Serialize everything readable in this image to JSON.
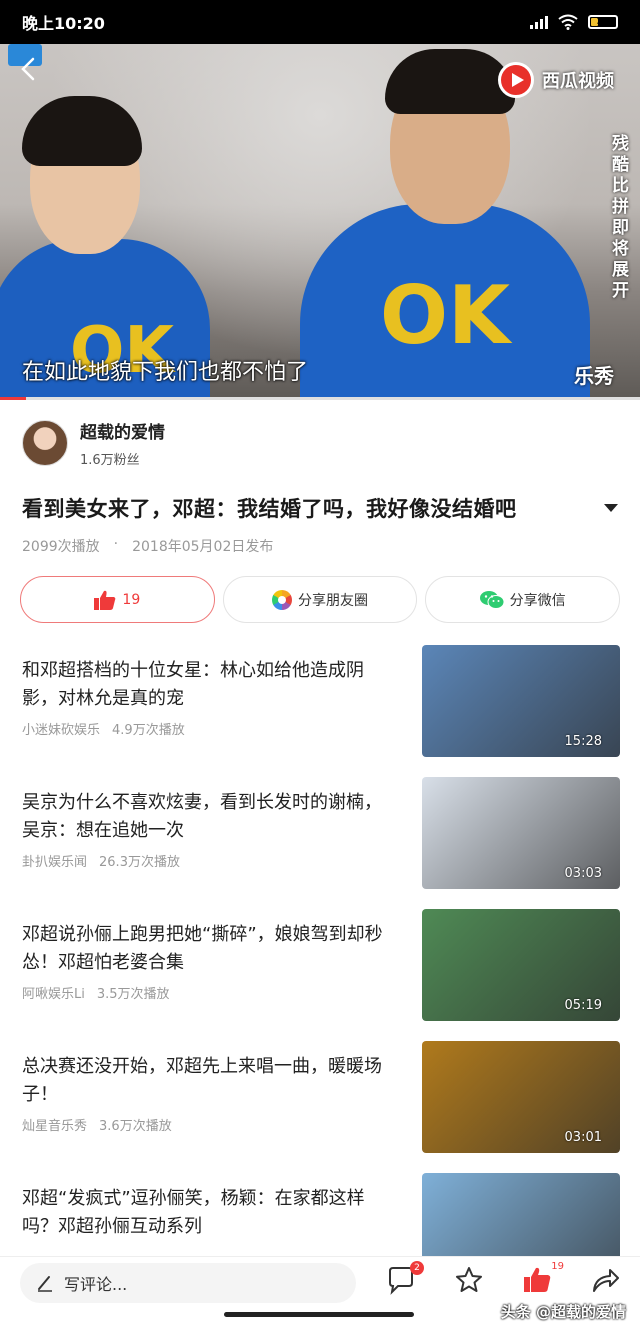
{
  "status_bar": {
    "time": "晚上10:20",
    "battery": "25"
  },
  "video": {
    "subtitle": "在如此地貌下我们也都不怕了",
    "brand_right": "乐秀",
    "platform_logo": "西瓜视频",
    "side_caption": "残酷比拼即将展开",
    "shirt_text": "OK",
    "progress_fraction": 0.04
  },
  "author": {
    "name": "超载的爱情",
    "fans": "1.6万粉丝"
  },
  "video_info": {
    "title": "看到美女来了，邓超：我结婚了吗，我好像没结婚吧",
    "plays": "2099次播放",
    "separator": "·",
    "published": "2018年05月02日发布"
  },
  "actions": {
    "like_count": "19",
    "share_moments": "分享朋友圈",
    "share_wechat": "分享微信"
  },
  "related": [
    {
      "title": "和邓超搭档的十位女星：林心如给他造成阴影，对林允是真的宠",
      "source": "小迷妹砍娱乐",
      "plays": "4.9万次播放",
      "duration": "15:28",
      "thumb_bg": "#5b86b8"
    },
    {
      "title": "吴京为什么不喜欢炫妻，看到长发时的谢楠，吴京：想在追她一次",
      "source": "卦扒娱乐闻",
      "plays": "26.3万次播放",
      "duration": "03:03",
      "thumb_bg": "#d8dfe8"
    },
    {
      "title": "邓超说孙俪上跑男把她“撕碎”，娘娘驾到却秒怂！邓超怕老婆合集",
      "source": "阿啾娱乐Li",
      "plays": "3.5万次播放",
      "duration": "05:19",
      "thumb_bg": "#4f8a55"
    },
    {
      "title": "总决赛还没开始，邓超先上来唱一曲，暖暖场子！",
      "source": "灿星音乐秀",
      "plays": "3.6万次播放",
      "duration": "03:01",
      "thumb_bg": "#b07a1c"
    },
    {
      "title": "邓超“发疯式”逗孙俪笑，杨颖：在家都这样吗？邓超孙俪互动系列",
      "source": "",
      "plays": "",
      "duration": "",
      "thumb_bg": "#7fb0d8"
    }
  ],
  "bottom_bar": {
    "comment_placeholder": "写评论...",
    "comment_badge": "2",
    "like_badge": "19",
    "watermark": "头条 @超载的爱情"
  },
  "colors": {
    "accent": "#ef3a3a",
    "wechat": "#2ecc71"
  },
  "icons": [
    "back-icon",
    "signal-icon",
    "wifi-icon",
    "battery-icon",
    "thumbs-up-icon",
    "moments-icon",
    "wechat-icon",
    "pencil-icon",
    "comment-icon",
    "star-icon",
    "share-icon"
  ]
}
